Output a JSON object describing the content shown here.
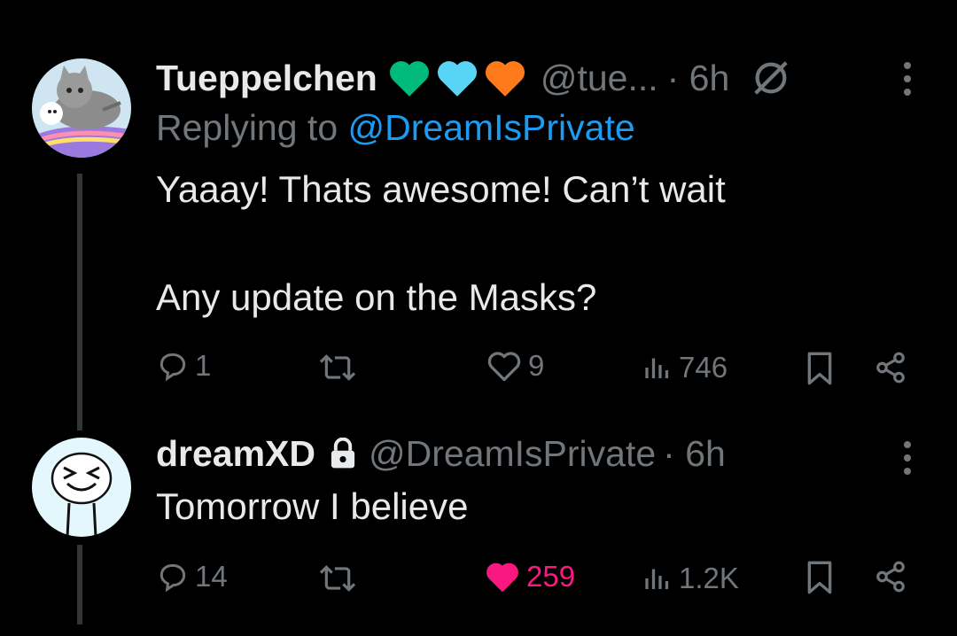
{
  "tweets": [
    {
      "name": "Tueppelchen",
      "hearts": [
        "#00ba7c",
        "#58d5f5",
        "#ff7a1a"
      ],
      "handle": "@tue...",
      "time": "· 6h",
      "replying_prefix": "Replying to ",
      "replying_to": "@DreamIsPrivate",
      "text_line1": "Yaaay! Thats awesome! Can’t wait",
      "text_line2": "Any update on the Masks?",
      "replies": "1",
      "retweets": "",
      "likes": "9",
      "views": "746",
      "liked": false
    },
    {
      "name": "dreamXD",
      "lock": "lock-icon",
      "handle": "@DreamIsPrivate",
      "time": "· 6h",
      "text_line1": "Tomorrow I believe",
      "replies": "14",
      "retweets": "",
      "likes": "259",
      "views": "1.2K",
      "liked": true,
      "like_color": "#f91880"
    }
  ]
}
